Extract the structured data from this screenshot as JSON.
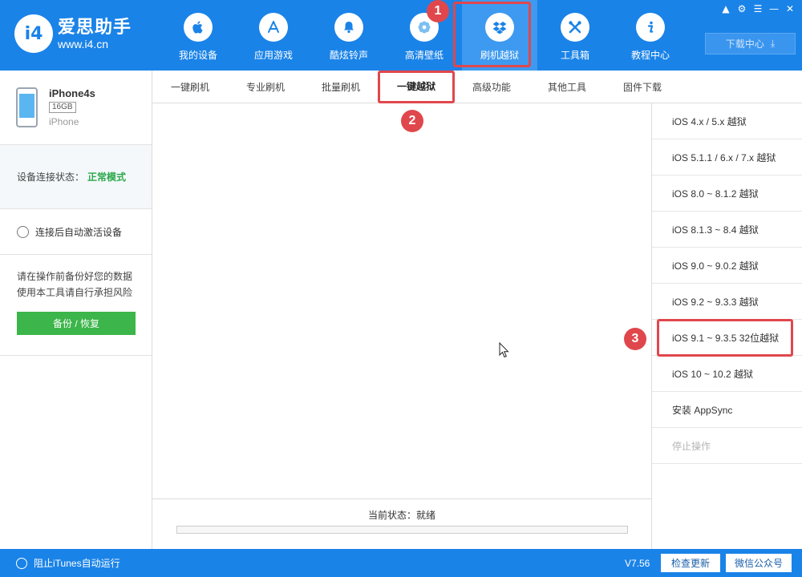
{
  "app": {
    "logo_mark": "i4",
    "logo_title": "爱思助手",
    "logo_url": "www.i4.cn"
  },
  "nav": [
    {
      "label": "我的设备",
      "icon": "apple-icon"
    },
    {
      "label": "应用游戏",
      "icon": "app-store-icon"
    },
    {
      "label": "酷炫铃声",
      "icon": "bell-icon"
    },
    {
      "label": "高清壁纸",
      "icon": "flower-icon"
    },
    {
      "label": "刷机越狱",
      "icon": "dropbox-icon",
      "active": true
    },
    {
      "label": "工具箱",
      "icon": "tools-icon"
    },
    {
      "label": "教程中心",
      "icon": "info-icon"
    }
  ],
  "window_controls": [
    "shirt-icon",
    "gear-icon",
    "menu-icon",
    "minimize-icon",
    "close-icon"
  ],
  "download_center": {
    "label": "下载中心"
  },
  "device": {
    "name": "iPhone4s",
    "capacity": "16GB",
    "type": "iPhone"
  },
  "connection": {
    "label": "设备连接状态：",
    "value": "正常模式",
    "value_color": "#2ba84a"
  },
  "auto_activate": {
    "label": "连接后自动激活设备"
  },
  "warning": {
    "line1": "请在操作前备份好您的数据",
    "line2": "使用本工具请自行承担风险"
  },
  "backup_button": {
    "label": "备份 / 恢复"
  },
  "subtabs": [
    {
      "label": "一键刷机"
    },
    {
      "label": "专业刷机"
    },
    {
      "label": "批量刷机"
    },
    {
      "label": "一键越狱",
      "active": true
    },
    {
      "label": "高级功能"
    },
    {
      "label": "其他工具"
    },
    {
      "label": "固件下载"
    }
  ],
  "status": {
    "label": "当前状态：就绪",
    "progress": 0
  },
  "jailbreak_options": [
    {
      "label": "iOS 4.x / 5.x 越狱"
    },
    {
      "label": "iOS 5.1.1 / 6.x / 7.x 越狱"
    },
    {
      "label": "iOS 8.0 ~ 8.1.2 越狱"
    },
    {
      "label": "iOS 8.1.3 ~ 8.4 越狱"
    },
    {
      "label": "iOS 9.0 ~ 9.0.2 越狱"
    },
    {
      "label": "iOS 9.2 ~ 9.3.3 越狱"
    },
    {
      "label": "iOS 9.1 ~ 9.3.5 32位越狱"
    },
    {
      "label": "iOS 10 ~ 10.2 越狱"
    },
    {
      "label": "安装 AppSync"
    },
    {
      "label": "停止操作",
      "disabled": true
    }
  ],
  "footer": {
    "itunes_label": "阻止iTunes自动运行",
    "version": "V7.56",
    "check_update": "检查更新",
    "wechat": "微信公众号"
  },
  "annotations": [
    {
      "number": "1"
    },
    {
      "number": "2"
    },
    {
      "number": "3"
    }
  ],
  "colors": {
    "brand_blue": "#1a83e8",
    "active_nav": "#3e9af0",
    "annotation_red": "#e0474c",
    "backup_green": "#3cb54a"
  }
}
